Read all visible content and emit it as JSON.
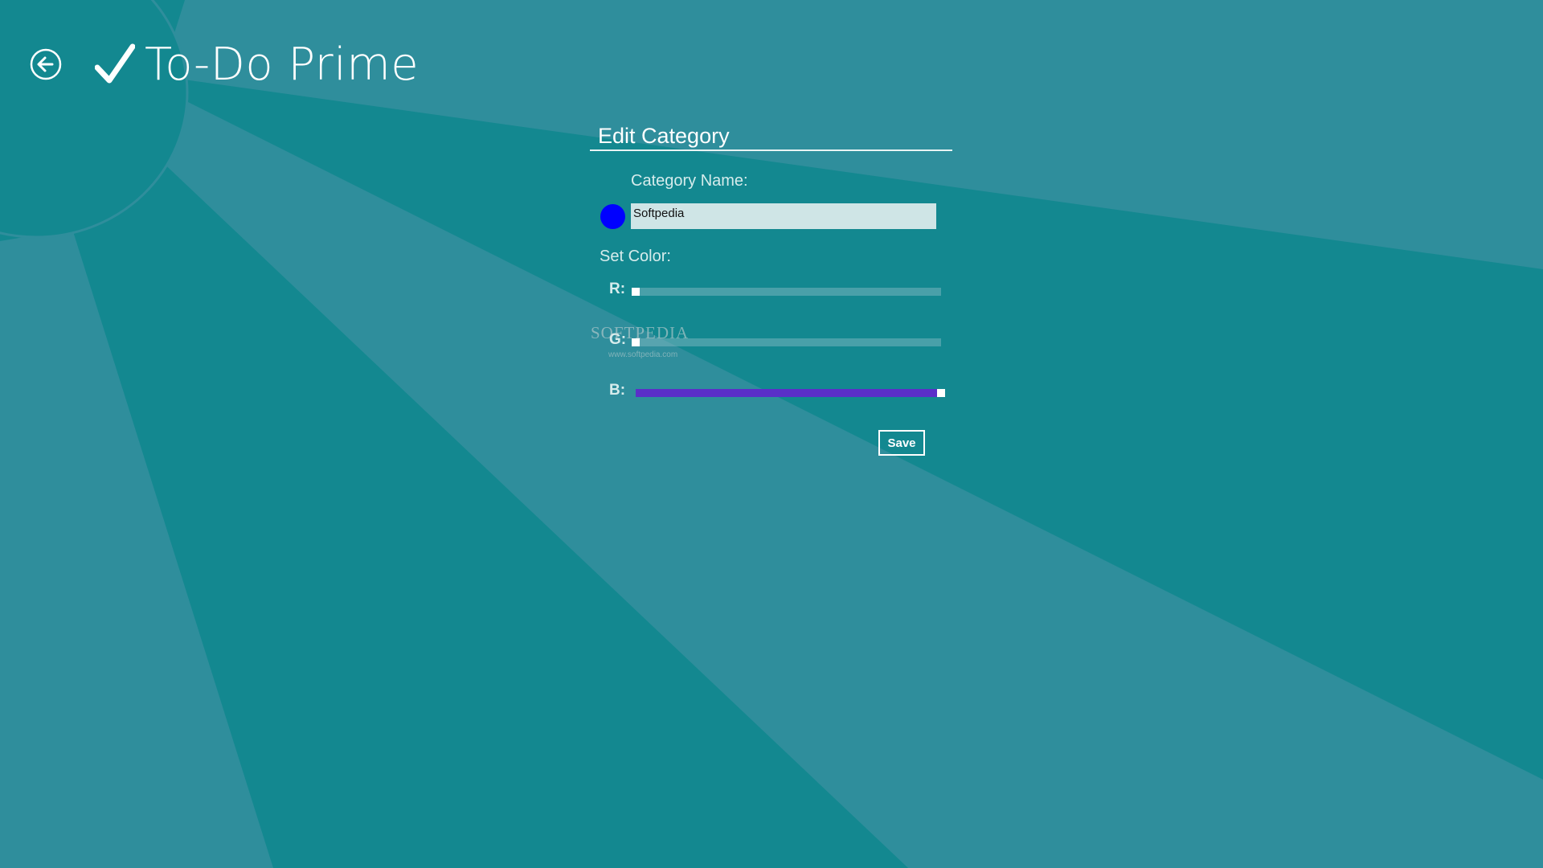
{
  "app": {
    "title": "To-Do Prime",
    "back_icon": "back-arrow-circle-icon",
    "title_icon": "checkmark-icon"
  },
  "panel": {
    "title": "Edit Category",
    "name_label": "Category Name:",
    "name_value": "Softpedia",
    "set_color_label": "Set Color:",
    "save_label": "Save"
  },
  "color": {
    "preview": "#0000ff",
    "sliders": [
      {
        "label": "R:",
        "value": 0,
        "max": 255
      },
      {
        "label": "G:",
        "value": 0,
        "max": 255
      },
      {
        "label": "B:",
        "value": 255,
        "max": 255
      }
    ]
  },
  "watermark": {
    "text": "SOFTPEDIA",
    "url": "www.softpedia.com"
  },
  "colors": {
    "background": "#138890",
    "ray_light": "#2f8e9c",
    "slider_fill": "#5a2fc8",
    "input_bg": "#cfe5e6"
  }
}
